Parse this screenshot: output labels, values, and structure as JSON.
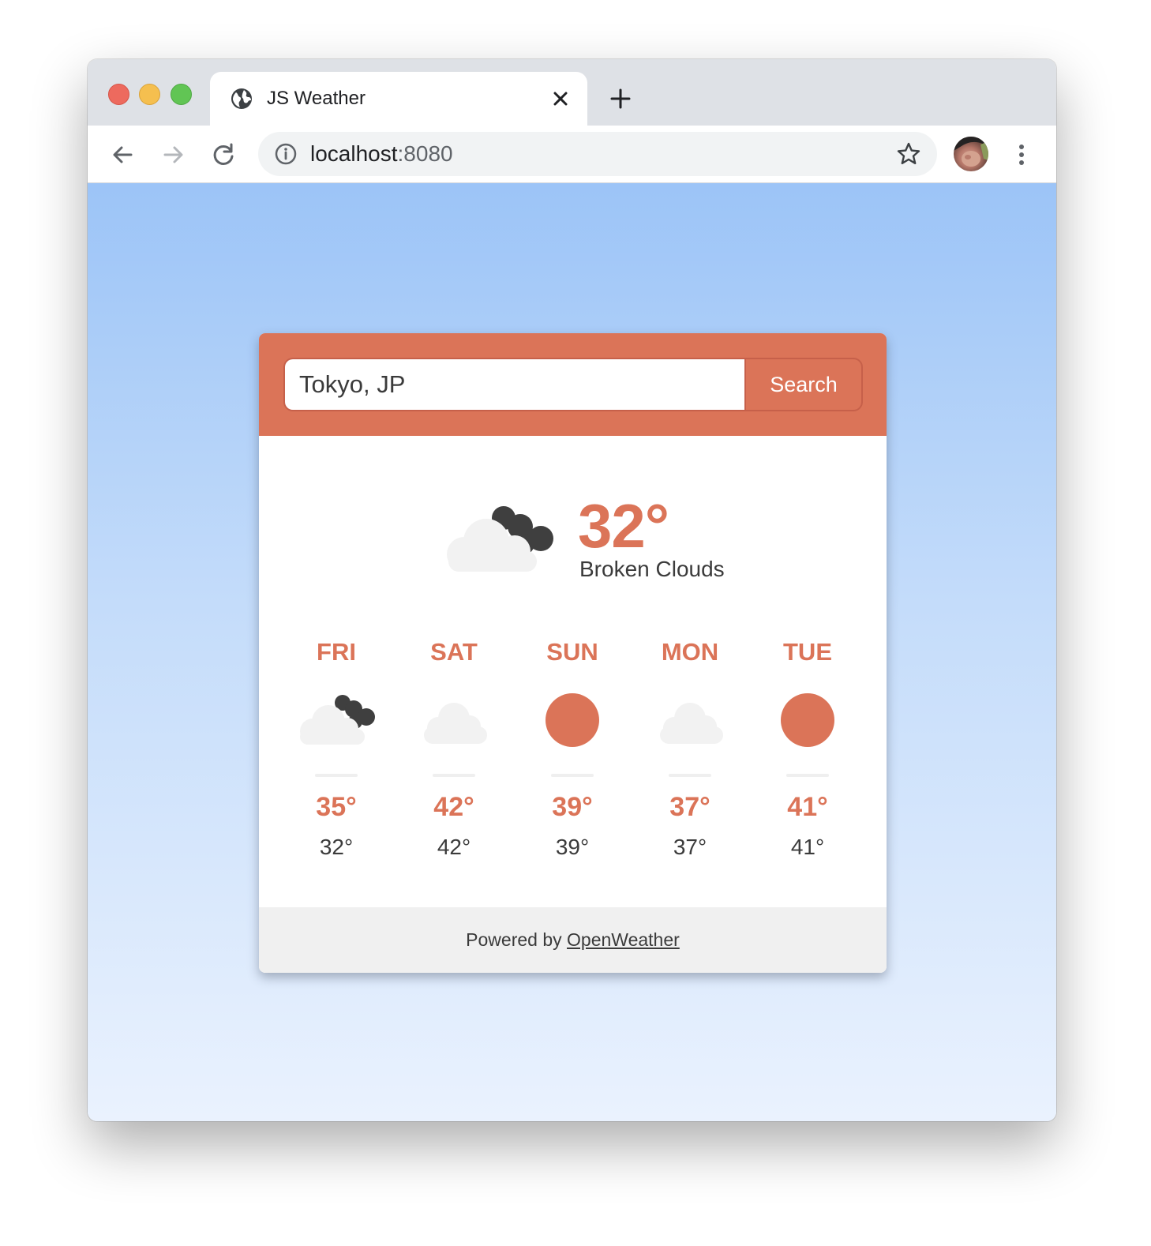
{
  "browser": {
    "tab_title": "JS Weather",
    "url_host": "localhost",
    "url_port": ":8080"
  },
  "search": {
    "value": "Tokyo, JP",
    "button_label": "Search"
  },
  "current": {
    "temp": "32°",
    "description": "Broken Clouds",
    "icon": "broken-clouds-icon"
  },
  "forecast": [
    {
      "day": "FRI",
      "icon": "broken-clouds-icon",
      "high": "35°",
      "low": "32°"
    },
    {
      "day": "SAT",
      "icon": "cloud-icon",
      "high": "42°",
      "low": "42°"
    },
    {
      "day": "SUN",
      "icon": "sun-icon",
      "high": "39°",
      "low": "39°"
    },
    {
      "day": "MON",
      "icon": "cloud-icon",
      "high": "37°",
      "low": "37°"
    },
    {
      "day": "TUE",
      "icon": "sun-icon",
      "high": "41°",
      "low": "41°"
    }
  ],
  "footer": {
    "prefix": "Powered by ",
    "link_text": "OpenWeather"
  },
  "colors": {
    "accent": "#db7458",
    "background_top": "#9cc4f7",
    "background_bottom": "#eaf2fe",
    "text": "#3b3b3b"
  }
}
